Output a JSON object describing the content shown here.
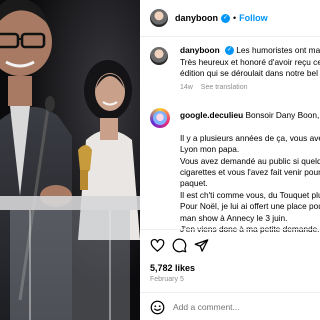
{
  "post": {
    "username": "danyboon",
    "follow_label": "Follow",
    "dot": "•",
    "caption_lines": [
      "Les humoristes ont main",
      "Très heureux et honoré d'avoir reçu ce",
      "édition qui se déroulait dans notre bel"
    ],
    "time": "14w",
    "see_translation": "See translation",
    "likes": "5,782 likes",
    "date": "February 5"
  },
  "comment": {
    "username": "google.deculieu",
    "lines": [
      "Bonsoir Dany Boon,",
      "",
      "Il y a plusieurs années de ça, vous avez",
      "Lyon mon papa.",
      "Vous avez demandé au public si quelq",
      "cigarettes et vous l'avez fait venir pour",
      "paquet.",
      "Il est ch'ti comme vous, du Touquet plu",
      "Pour Noël, je lui ai offert une place pou",
      "man show à Annecy le 3 juin.",
      "J'en viens donc à ma petite demande..."
    ]
  },
  "add_comment": {
    "placeholder": "Add a comment..."
  },
  "icons": {
    "verified": "verified-badge-icon",
    "like": "heart-icon",
    "comment": "comment-bubble-icon",
    "share": "paper-plane-icon",
    "emoji": "smiley-icon"
  },
  "colors": {
    "accent": "#0095f6",
    "muted": "#8e8e8e"
  }
}
